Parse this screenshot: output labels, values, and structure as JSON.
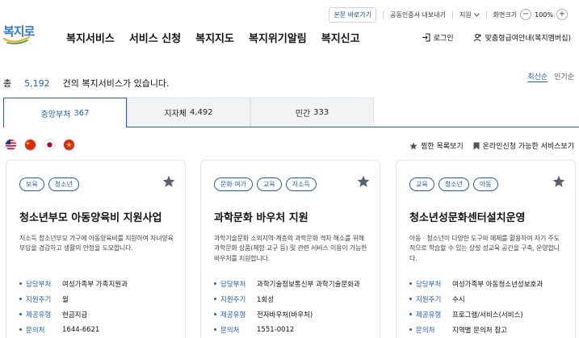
{
  "util": {
    "skip": "본문 바로가기",
    "cert": "공동인증서 내보내기",
    "lang": "지원",
    "zoom_label": "화면크기",
    "zoom_value": "100%"
  },
  "header": {
    "logo_text": "복지로",
    "nav": [
      "복지서비스",
      "서비스 신청",
      "복지지도",
      "복지위기알림",
      "복지신고"
    ],
    "login": "로그인",
    "member": "맞춤형급여안내(복지멤버십)"
  },
  "summary": {
    "prefix": "총",
    "count": "5,192",
    "suffix": "건의 복지서비스가 있습니다.",
    "sort_latest": "최신순",
    "sort_popular": "인기순"
  },
  "tabs": [
    {
      "label": "중앙부처",
      "count": "367"
    },
    {
      "label": "지자체",
      "count": "4,492"
    },
    {
      "label": "민간",
      "count": "333"
    }
  ],
  "options": {
    "favorites": "찜한 목록보기",
    "online": "온라인신청 가능한 서비스보기"
  },
  "field_labels": {
    "dept": "담당부처",
    "cycle": "지원주기",
    "type": "제공유형",
    "contact": "문의처"
  },
  "cards": [
    {
      "tags": [
        "보육",
        "청소년"
      ],
      "title": "청소년부모 아동양육비 지원사업",
      "desc": "저소득 청소년부모 가구에 아동양육비를 지원하여 자녀양육 부담을 경감하고 생활의 안정을 도모합니다.",
      "dept": "여성가족부 가족지원과",
      "cycle": "월",
      "type": "현금지급",
      "contact": "1644-6621"
    },
    {
      "tags": [
        "문화·여가",
        "교육",
        "저소득"
      ],
      "title": "과학문화 바우처 지원",
      "desc": "과학기술문화 소외지역·계층의 과학문화 격차 해소를 위해 과학문화 상품(체험·교구 등) 및 관련 서비스 이용이 가능한 바우처를 지원합니다.",
      "dept": "과학기술정보통신부 과학기술문화과",
      "cycle": "1회성",
      "type": "전자바우처(바우처)",
      "contact": "1551-0012"
    },
    {
      "tags": [
        "교육",
        "청소년",
        "아동"
      ],
      "title": "청소년성문화센터설치운영",
      "desc": "아동 · 청소년이 다양한 도구와 매체를 활용하여 자기 주도적으로 학습할 수 있는 상설 성교육 공간을 구축, 운영합니다.",
      "dept": "여성가족부 아동청소년성보호과",
      "cycle": "수시",
      "type": "프로그램/서비스(서비스)",
      "contact": "지역별 문의처 참고"
    }
  ],
  "colors": {
    "accent": "#1f5bd4",
    "star": "#5c5f70"
  }
}
